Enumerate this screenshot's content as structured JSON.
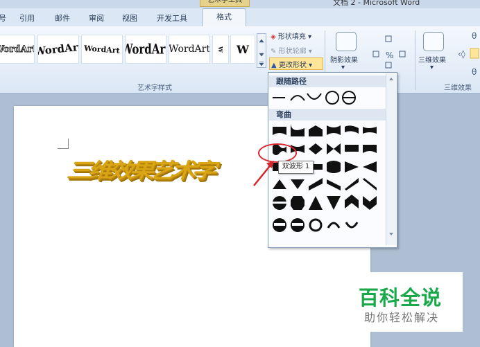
{
  "window": {
    "context_header": "艺术字工具",
    "doc_title": "文档 2 - Microsoft Word"
  },
  "tabs": [
    "引用",
    "邮件",
    "审阅",
    "视图",
    "开发工具"
  ],
  "tab_partial": "号",
  "active_tab": "格式",
  "ribbon": {
    "wordart_gallery": [
      "WordArt",
      "WordArt",
      "WordArt",
      "WordArt",
      "WordArt",
      "W",
      "W"
    ],
    "wordart_styles_label": "艺术字样式",
    "shape_fill": "形状填充",
    "shape_outline": "形状轮廓",
    "change_shape": "更改形状",
    "shadow_effects": "阴影效果",
    "threed_effects_button": "三维效果",
    "threed_effects_label": "三维效果"
  },
  "document": {
    "wordart_text": "三维效果艺术字"
  },
  "dropdown": {
    "section_follow_path": "跟随路径",
    "section_warp": "弯曲",
    "tooltip": "双波形 1"
  },
  "watermark": {
    "title": "百科全说",
    "subtitle": "助你轻松解决"
  },
  "colors": {
    "ribbon_bg": "#dbe7f5",
    "document_bg": "#aebfd3",
    "wordart_gold": "#d9a515",
    "highlight_red": "#d8272b",
    "watermark_green": "#19a84a"
  }
}
